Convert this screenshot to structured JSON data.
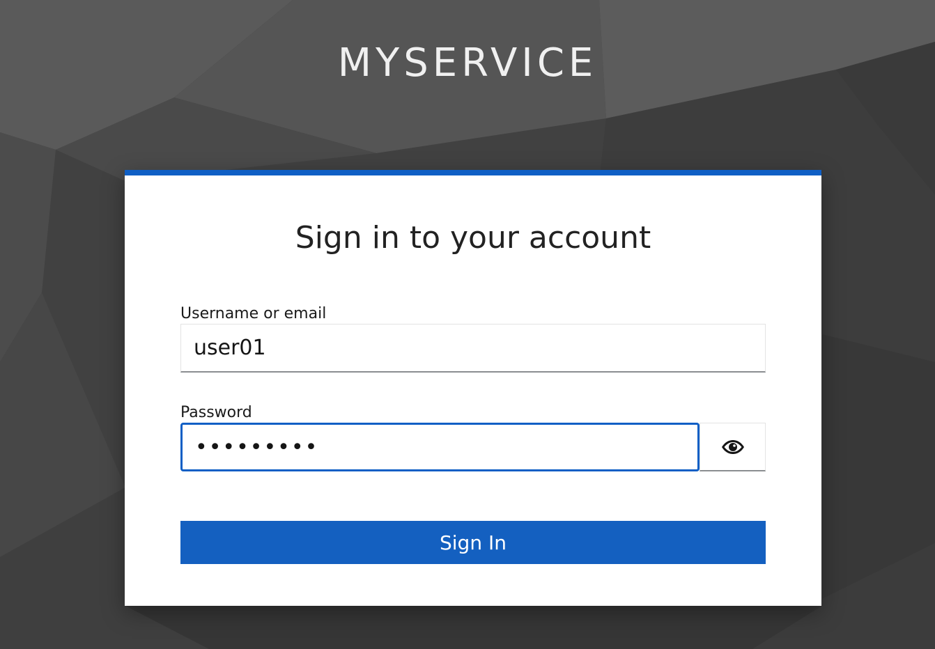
{
  "brand": {
    "title": "MYSERVICE"
  },
  "login": {
    "title": "Sign in to your account",
    "username": {
      "label": "Username or email",
      "value": "user01"
    },
    "password": {
      "label": "Password",
      "value": "•••••••••",
      "toggle_icon": "eye-icon"
    },
    "submit_label": "Sign In"
  },
  "colors": {
    "accent": "#1460c0",
    "background": "#3c3c3c",
    "card": "#ffffff"
  }
}
